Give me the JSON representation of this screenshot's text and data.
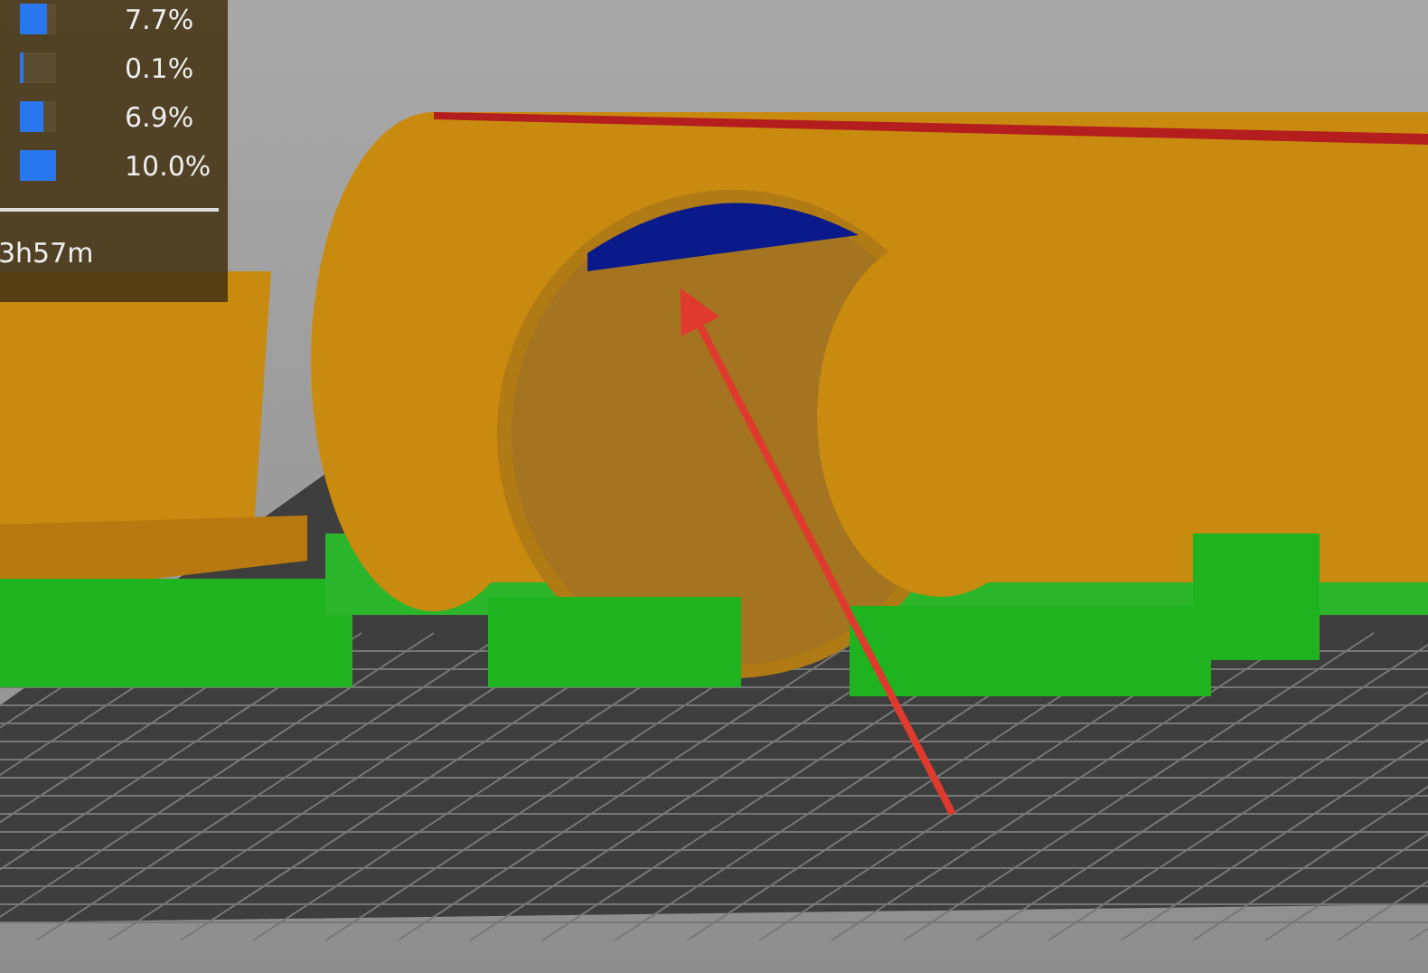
{
  "legend": {
    "rows": [
      {
        "percent": "7.7%",
        "level": 0.75
      },
      {
        "percent": "0.1%",
        "level": 0.08
      },
      {
        "percent": "6.9%",
        "level": 0.65
      },
      {
        "percent": "10.0%",
        "level": 1.0
      }
    ],
    "time": "3h57m"
  }
}
